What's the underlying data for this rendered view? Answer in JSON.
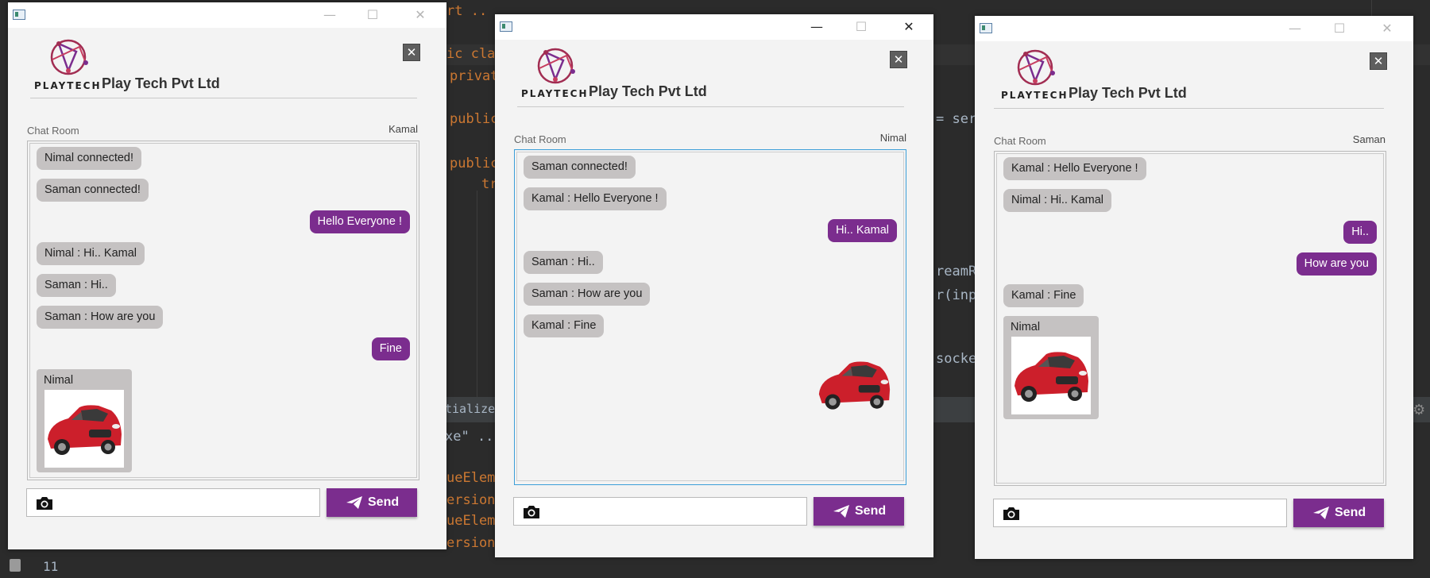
{
  "company": "Play Tech Pvt Ltd",
  "logo_text": "PLAYTECH",
  "chat_room_label": "Chat Room",
  "send_label": "Send",
  "close_label": "✕",
  "colors": {
    "outgoing": "#7b2d8e",
    "incoming": "#c5c2c2",
    "send_button": "#7b2d8e"
  },
  "ide": {
    "line1": "rt ..",
    "line2": "ic cla",
    "line3": "privat",
    "line4": "public",
    "line5": "= ser",
    "line6": "public",
    "line7": "tr",
    "line8": "reamR",
    "line9": "r(inp",
    "line10": "socke",
    "tab": "tializer  ✕",
    "line11": "xe\" ..",
    "line12": "ueElem",
    "line13": "ersion",
    "line14": "ueElem",
    "line15": "ersion",
    "line_number": "11"
  },
  "windows": [
    {
      "user": "Kamal",
      "messages": [
        {
          "text": "Nimal connected!",
          "dir": "in"
        },
        {
          "text": "Saman connected!",
          "dir": "in"
        },
        {
          "text": "Hello Everyone !",
          "dir": "out"
        },
        {
          "text": "Nimal : Hi.. Kamal",
          "dir": "in"
        },
        {
          "text": "Saman : Hi..",
          "dir": "in"
        },
        {
          "text": "Saman : How are you",
          "dir": "in"
        },
        {
          "text": "Fine",
          "dir": "out"
        }
      ],
      "image_message": {
        "sender": "Nimal"
      }
    },
    {
      "user": "Nimal",
      "messages": [
        {
          "text": "Saman connected!",
          "dir": "in"
        },
        {
          "text": "Kamal : Hello Everyone !",
          "dir": "in"
        },
        {
          "text": "Hi.. Kamal",
          "dir": "out"
        },
        {
          "text": "Saman : Hi..",
          "dir": "in"
        },
        {
          "text": "Saman : How are you",
          "dir": "in"
        },
        {
          "text": "Kamal : Fine",
          "dir": "in"
        }
      ]
    },
    {
      "user": "Saman",
      "messages": [
        {
          "text": "Kamal : Hello Everyone !",
          "dir": "in"
        },
        {
          "text": "Nimal : Hi.. Kamal",
          "dir": "in"
        },
        {
          "text": "Hi..",
          "dir": "out"
        },
        {
          "text": "How are you",
          "dir": "out"
        },
        {
          "text": "Kamal : Fine",
          "dir": "in"
        }
      ],
      "image_message": {
        "sender": "Nimal"
      }
    }
  ]
}
